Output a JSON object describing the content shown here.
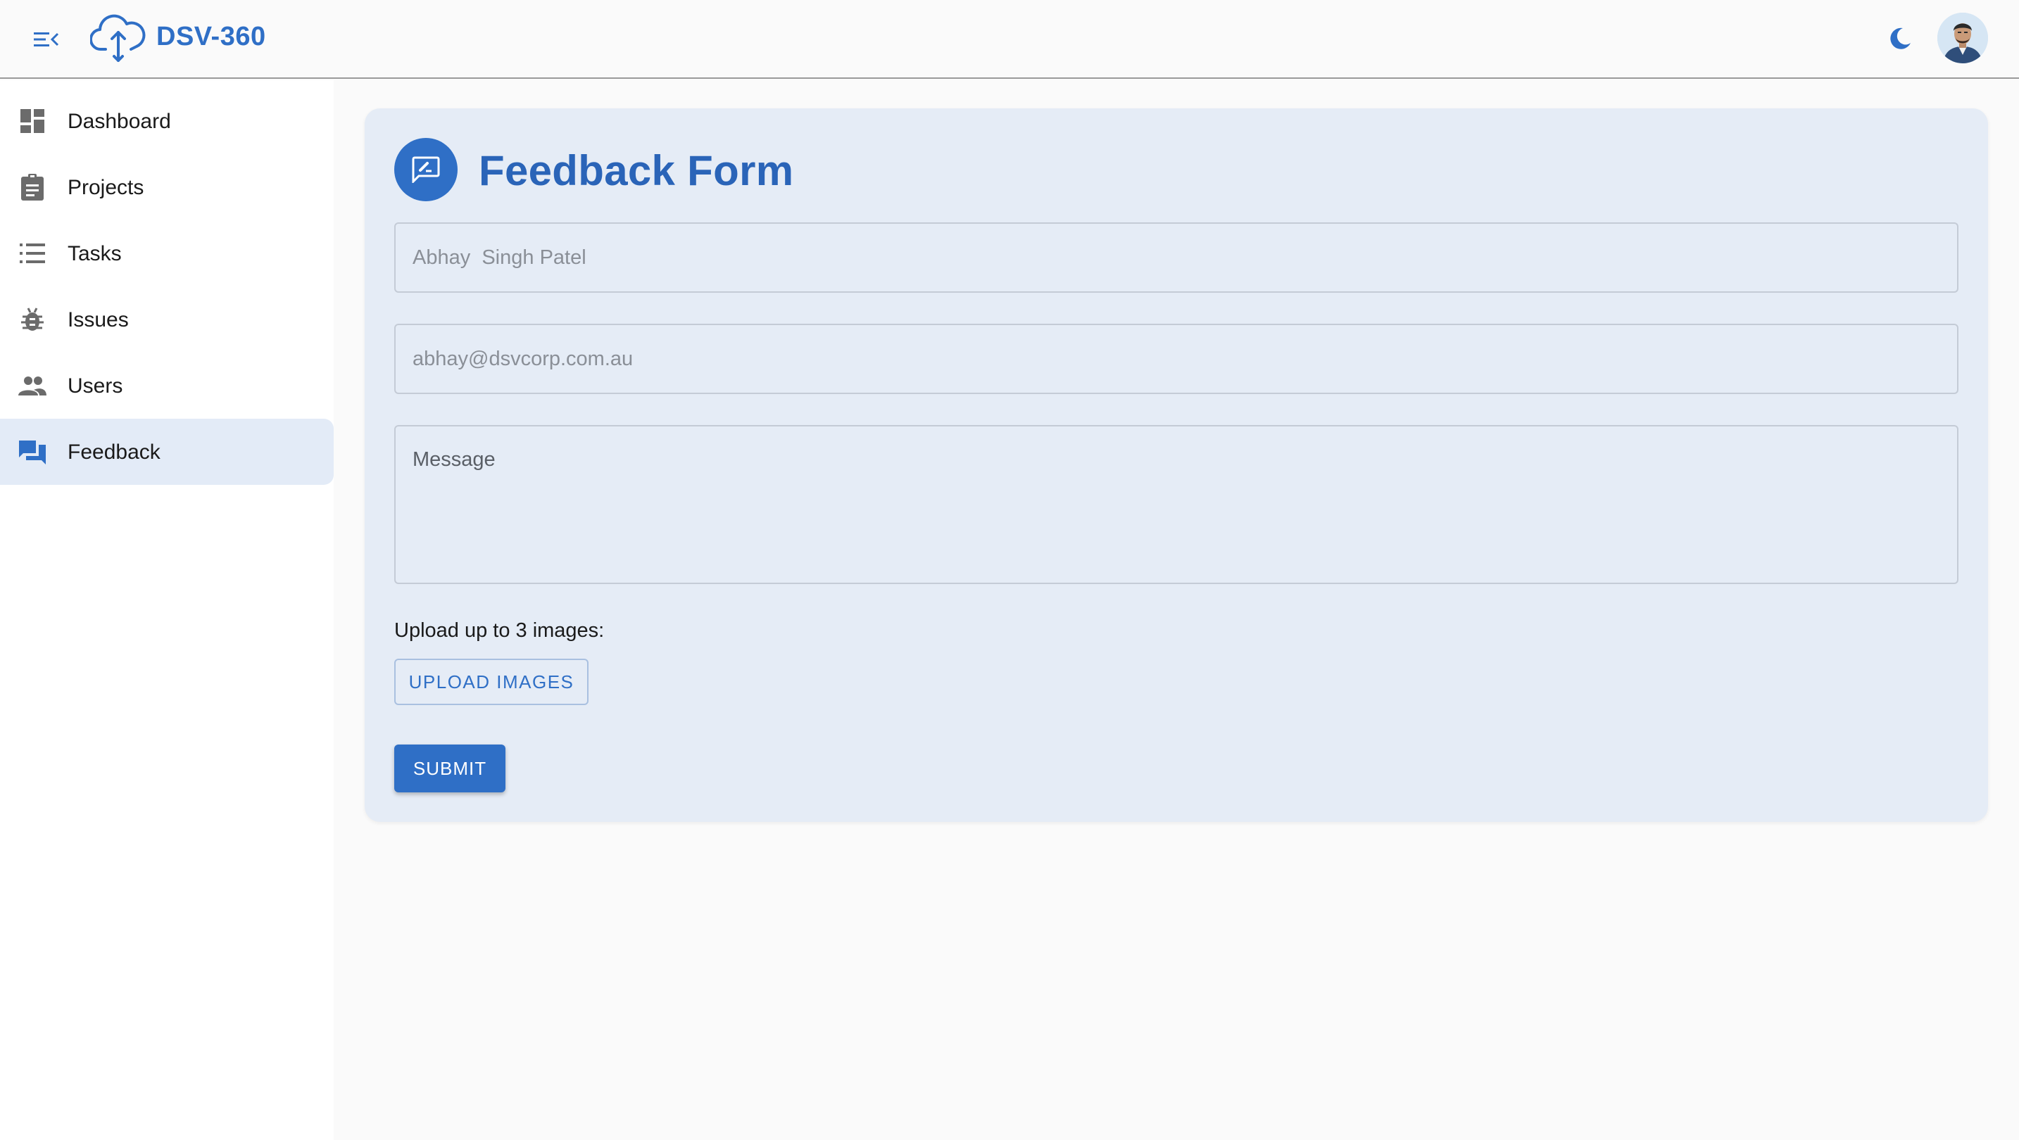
{
  "header": {
    "brand": "DSV-360",
    "menu_icon": "menu-collapse-icon",
    "theme_icon": "moon-icon",
    "avatar_icon": "user-avatar"
  },
  "colors": {
    "accent": "#2f6fc6",
    "title": "#2a64b8",
    "card_background": "#e5ecf6",
    "active_nav_background": "#e3ebf7",
    "nav_icon": "#6b6b6b"
  },
  "sidebar": {
    "items": [
      {
        "label": "Dashboard",
        "icon": "dashboard-icon",
        "active": false
      },
      {
        "label": "Projects",
        "icon": "clipboard-icon",
        "active": false
      },
      {
        "label": "Tasks",
        "icon": "list-icon",
        "active": false
      },
      {
        "label": "Issues",
        "icon": "bug-icon",
        "active": false
      },
      {
        "label": "Users",
        "icon": "users-icon",
        "active": false
      },
      {
        "label": "Feedback",
        "icon": "feedback-icon",
        "active": true
      }
    ]
  },
  "form": {
    "title": "Feedback Form",
    "icon": "feedback-edit-icon",
    "name_value": "Abhay  Singh Patel",
    "email_value": "abhay@dsvcorp.com.au",
    "message_placeholder": "Message",
    "upload_label": "Upload up to 3 images:",
    "upload_button": "UPLOAD IMAGES",
    "submit_button": "SUBMIT"
  }
}
